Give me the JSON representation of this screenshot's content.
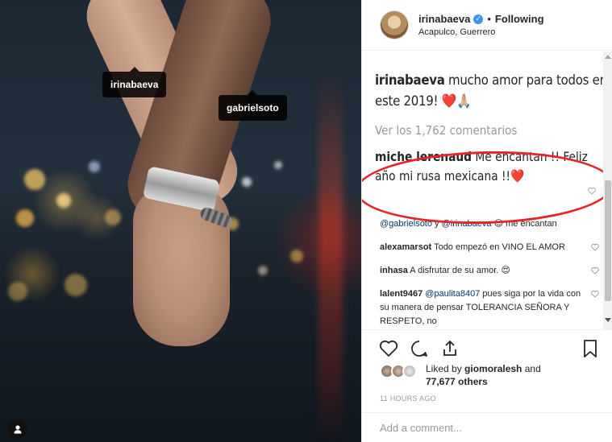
{
  "photo": {
    "tags": [
      {
        "label": "irinabaeva"
      },
      {
        "label": "gabrielsoto"
      }
    ],
    "user_tag_icon": "person-icon"
  },
  "header": {
    "username": "irinabaeva",
    "verified_icon": "verified-badge-icon",
    "separator": "•",
    "follow_status": "Following",
    "location": "Acapulco, Guerrero"
  },
  "caption": {
    "username": "irinabaeva",
    "text": " mucho amor para todos en este 2019! ❤️🙏🏼"
  },
  "view_all": "Ver los 1,762 comentarios",
  "highlight_comment": {
    "username": "miche lerenaud",
    "text": " Me encantan !! Feliz año mi rusa mexicana !!❤️"
  },
  "comments": [
    {
      "mention1": "@gabrielsoto",
      "connector": " y ",
      "mention2": "@irinabaeva",
      "text": " 😍 me encantan"
    },
    {
      "username": "alexamarsot",
      "text": " Todo empezó en VINO EL AMOR"
    },
    {
      "username": "inhasa",
      "text": " A disfrutar de su amor. 😍"
    },
    {
      "username": "lalent9467",
      "mention": " @paulita8407",
      "text": " pues siga por la vida con su manera de pensar TOLERANCIA SEÑORA Y RESPETO, no"
    }
  ],
  "actions": {
    "like_icon": "heart-icon",
    "comment_icon": "comment-icon",
    "share_icon": "share-icon",
    "save_icon": "bookmark-icon"
  },
  "likes": {
    "prefix": "Liked by ",
    "user": "giomoralesh",
    "connector": " and",
    "others": "77,677 others"
  },
  "timestamp": "11 HOURS AGO",
  "add_comment": {
    "placeholder": "Add a comment..."
  },
  "colors": {
    "accent": "#3897f0",
    "annotation": "#e3262b",
    "heart": "#e0245e"
  }
}
